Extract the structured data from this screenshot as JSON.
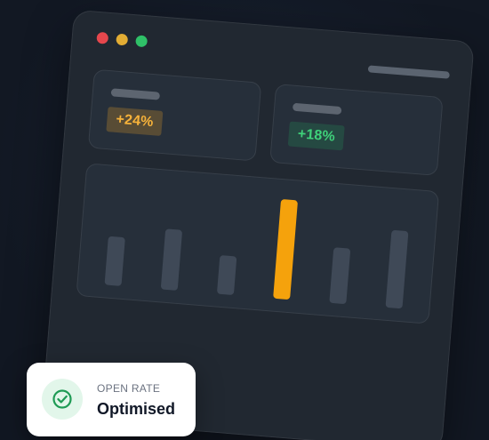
{
  "window": {
    "traffic_lights": [
      {
        "name": "close",
        "color": "#e6474d"
      },
      {
        "name": "minimize",
        "color": "#e3ad34"
      },
      {
        "name": "maximize",
        "color": "#2fc168"
      }
    ]
  },
  "stats": [
    {
      "value": "+24%",
      "accent": "#f6b23a"
    },
    {
      "value": "+18%",
      "accent": "#3fd17a"
    }
  ],
  "chart_data": {
    "type": "bar",
    "values": [
      0.49,
      0.61,
      0.39,
      1.0,
      0.56,
      0.78
    ],
    "highlight_index": 3,
    "highlight_color": "#f5a20c",
    "bar_color": "#3f4957"
  },
  "toast": {
    "label": "OPEN RATE",
    "value": "Optimised",
    "icon": "check-circle-icon",
    "icon_color": "#1f9b55"
  }
}
